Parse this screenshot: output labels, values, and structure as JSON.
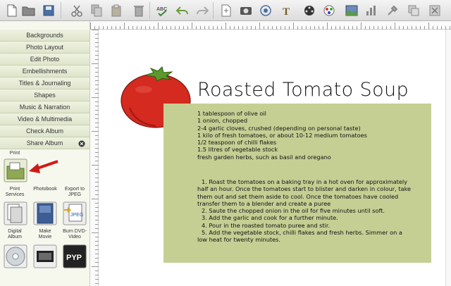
{
  "toolbar": {
    "icons": [
      "new-icon",
      "open-icon",
      "save-icon",
      "cut-icon",
      "copy-icon",
      "paste-icon",
      "delete-icon",
      "spellcheck-icon",
      "undo-icon",
      "redo-icon",
      "crop-icon",
      "photo-icon",
      "effects-icon",
      "text-icon",
      "film-icon",
      "color-icon",
      "image-icon",
      "chart-icon",
      "tools-icon",
      "duplicate-icon",
      "delete-page-icon"
    ]
  },
  "sidebar": {
    "items": [
      {
        "label": "Backgrounds"
      },
      {
        "label": "Photo Layout"
      },
      {
        "label": "Edit Photo"
      },
      {
        "label": "Embellishments"
      },
      {
        "label": "Titles & Journaling"
      },
      {
        "label": "Shapes"
      },
      {
        "label": "Music & Narration"
      },
      {
        "label": "Video & Multimedia"
      },
      {
        "label": "Check Album"
      },
      {
        "label": "Share Album"
      }
    ],
    "tools": {
      "print": "Print",
      "print_services": "Print Services",
      "photobook": "Photobook",
      "export_jpeg": "Export to JPEG",
      "digital_album": "Digital Album",
      "make_movie": "Make Movie",
      "burn_dvd": "Burn DVD-Video"
    }
  },
  "page": {
    "title": "Roasted Tomato Soup",
    "ingredients": [
      "1 tablespoon of olive oil",
      "1 onion, chopped",
      "2-4 garlic cloves, crushed (depending on personal taste)",
      "1 kilo of fresh tomatoes, or about 10-12 medium tomatoes",
      "1/2 teaspoon of chilli flakes",
      "1.5 litres of vegetable stock",
      "fresh garden herbs, such as basil and oregano"
    ],
    "steps": [
      "1. Roast the tomatoes on a baking tray in a hot oven for approximately",
      "half an hour. Once the tomatoes start to blister and darken in colour, take",
      "them out and set them aside to cool. Once the tomatoes have cooled",
      "transfer them to a blender and create a puree",
      "2. Saute the chopped onion in the oil for five minutes until soft.",
      "3. Add the garlic and cook for a further minute.",
      "4. Pour in the roasted tomato puree and stir.",
      "5. Add the vegetable stock, chilli flakes and fresh herbs. Simmer on a",
      "low heat for twenty minutes."
    ]
  },
  "colors": {
    "card": "#c5cf94",
    "tomato": "#d42a1f",
    "arrow": "#d01818"
  }
}
